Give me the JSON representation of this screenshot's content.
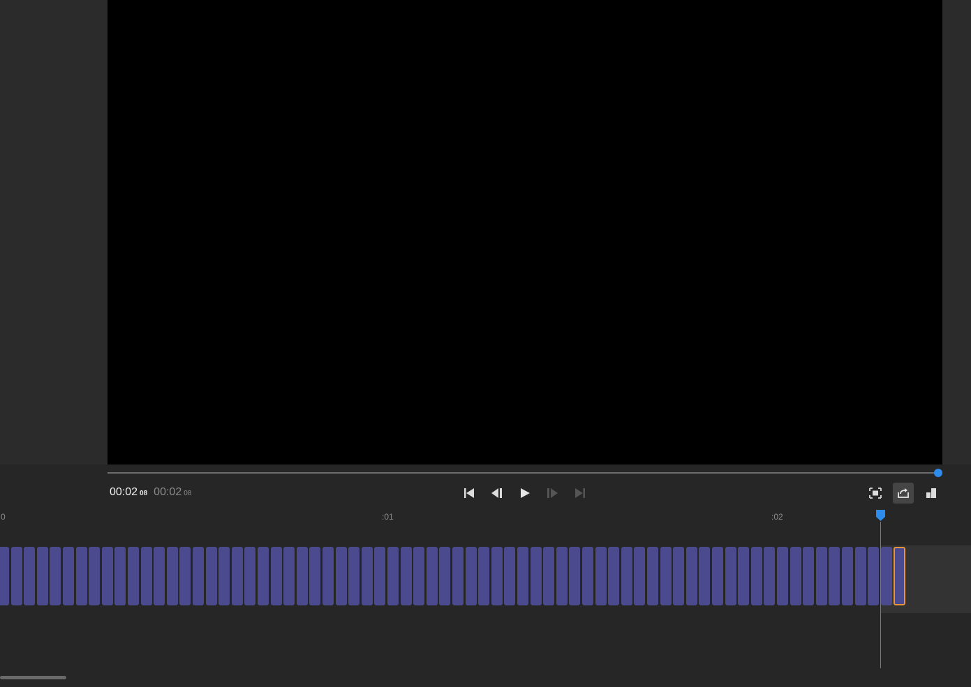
{
  "viewer": {
    "current_time": "00:02",
    "current_frames": "08",
    "duration_time": "00:02",
    "duration_frames": "08",
    "progress_fraction": 1.0
  },
  "transport": {
    "buttons": [
      {
        "name": "go-to-start-icon",
        "enabled": true
      },
      {
        "name": "step-back-icon",
        "enabled": true
      },
      {
        "name": "play-icon",
        "enabled": true
      },
      {
        "name": "step-forward-icon",
        "enabled": false
      },
      {
        "name": "go-to-end-icon",
        "enabled": false
      }
    ]
  },
  "view_tools": [
    {
      "name": "fit-to-screen-icon",
      "active": false
    },
    {
      "name": "export-frame-icon",
      "active": true
    },
    {
      "name": "layout-toggle-icon",
      "active": false
    }
  ],
  "timeline": {
    "ruler_labels": [
      "0",
      ":01",
      ":02"
    ],
    "frame_count": 70,
    "selected_frame_index": 69
  },
  "colors": {
    "accent": "#2d8ceb",
    "frame_fill": "#4b4a8e",
    "selection": "#e8943a"
  }
}
